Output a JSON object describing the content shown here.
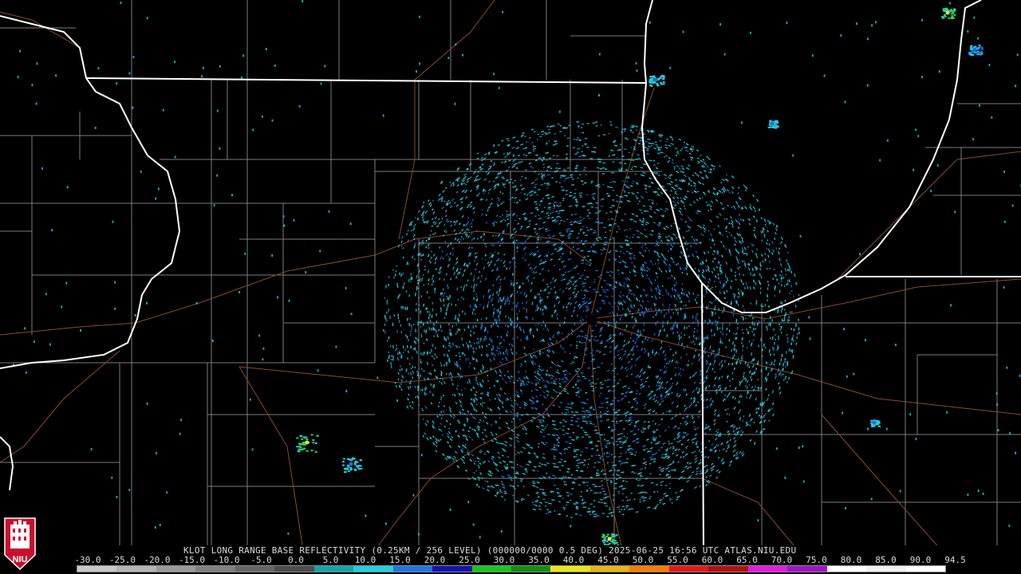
{
  "product_title": "KLOT LONG RANGE BASE REFLECTIVITY (0.25KM / 256 LEVEL) (000000/0000 0.5 DEG) 2025-06-25 16:56 UTC  ATLAS.NIU.EDU",
  "scale_labels": [
    "-30.0",
    "-25.0",
    "-20.0",
    "-15.0",
    "-10.0",
    "-5.0",
    "0.0",
    "5.0",
    "10.0",
    "15.0",
    "20.0",
    "25.0",
    "30.0",
    "35.0",
    "40.0",
    "45.0",
    "50.0",
    "55.0",
    "60.0",
    "65.0",
    "70.0",
    "75.0",
    "80.0",
    "85.0",
    "90.0",
    "94.5"
  ],
  "logo_text": "NIU",
  "colors": {
    "background": "#000000",
    "state_border": "#ffffff",
    "county_border": "#8a8a8a",
    "road": "#a0522d",
    "echo_light": "#29c9d9",
    "echo_mid": "#1e6fe0",
    "echo_strong": "#1fc81f",
    "logo_red": "#c8102e"
  },
  "colorbar": [
    "#c8c8c8",
    "#b4b4b4",
    "#9a9a9a",
    "#808080",
    "#666666",
    "#4d4d4d",
    "#12a6a6",
    "#20d0e0",
    "#1c78e8",
    "#1414b4",
    "#18c818",
    "#109010",
    "#e8e818",
    "#e8b414",
    "#ff7a00",
    "#e81818",
    "#b41010",
    "#e818e8",
    "#a014c8",
    "#ffffff",
    "#f0f0f0",
    "#ffffff"
  ]
}
